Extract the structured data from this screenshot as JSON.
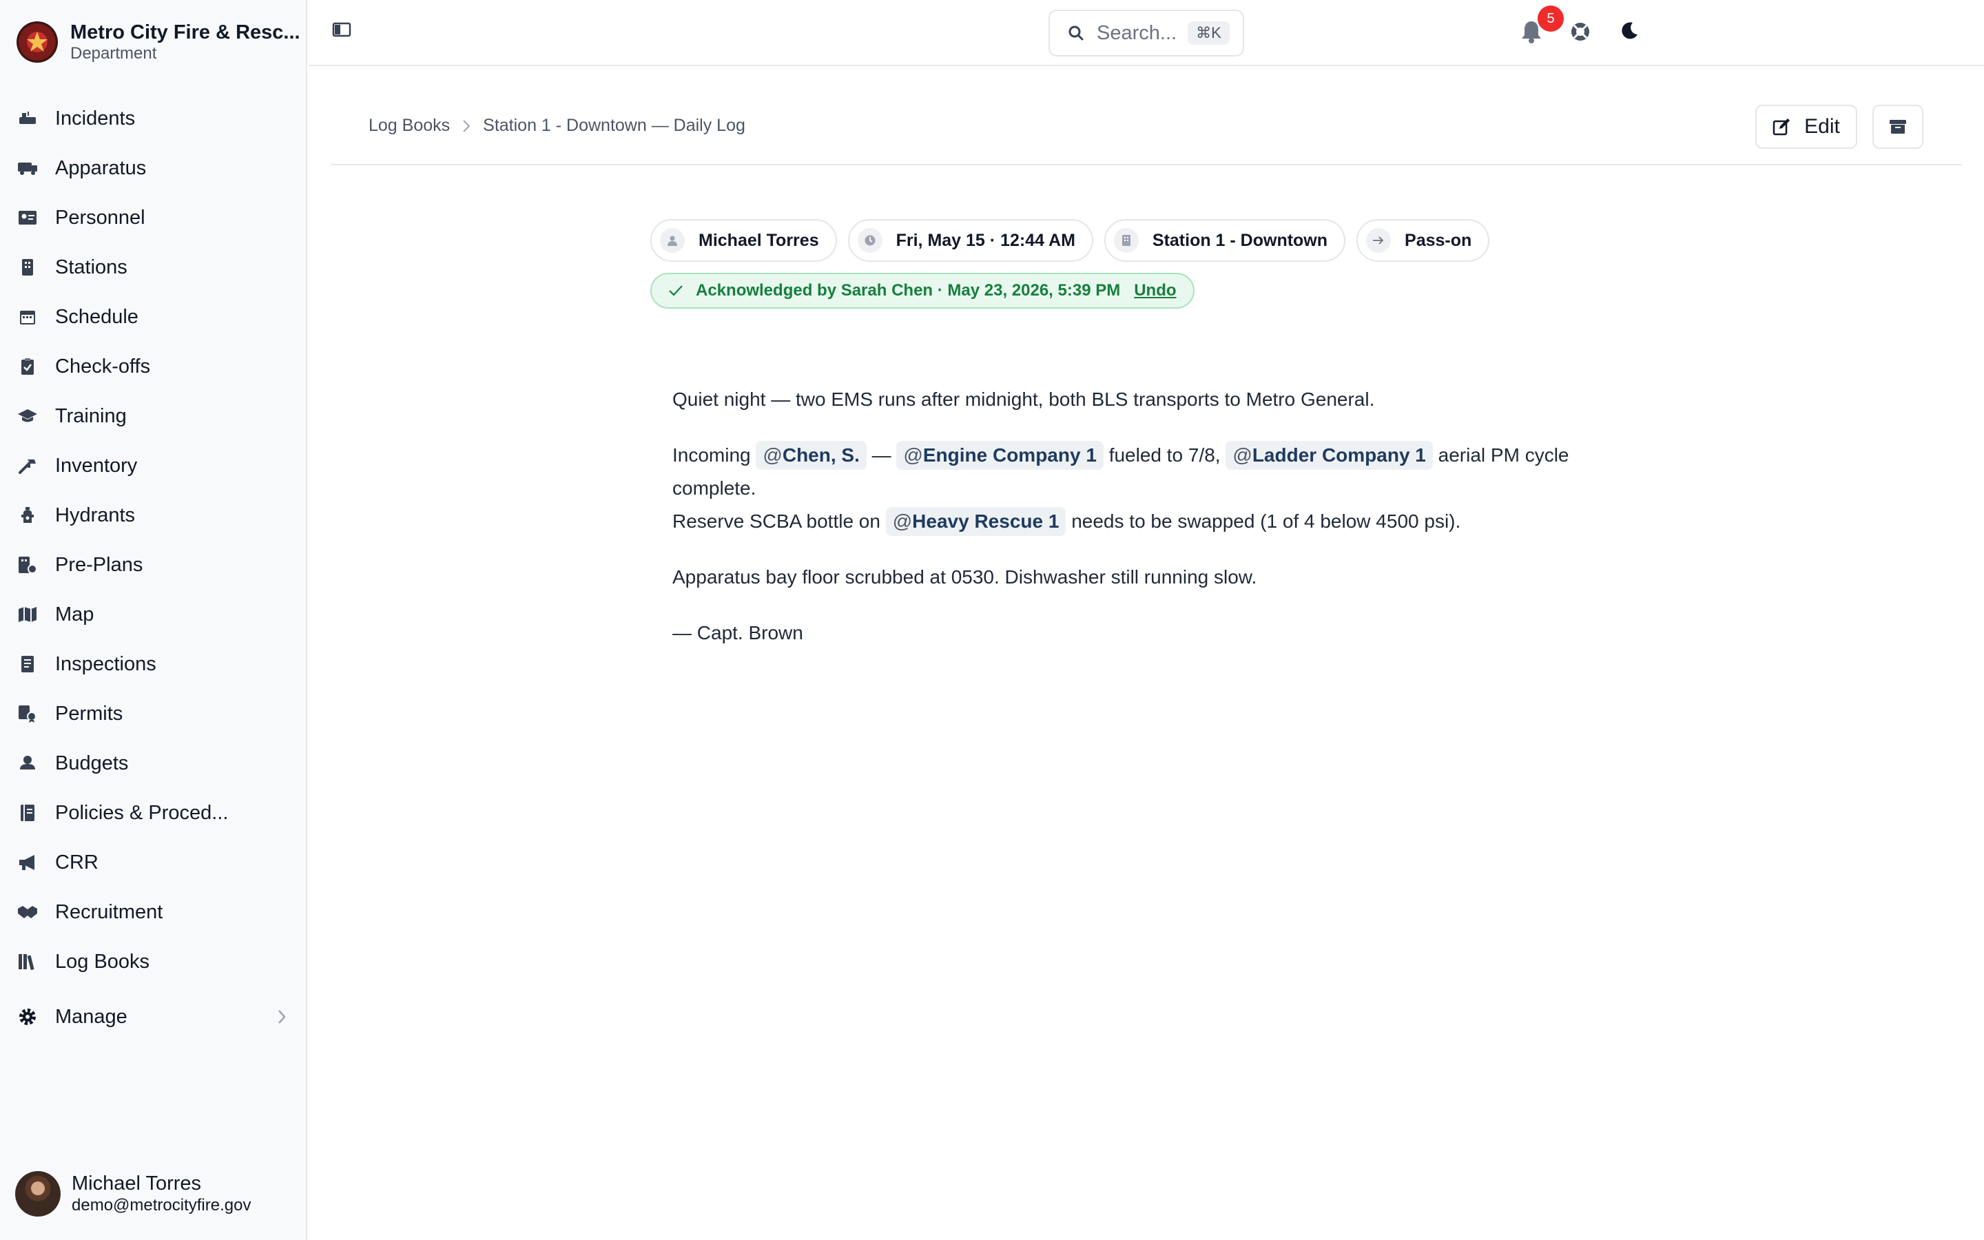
{
  "org": {
    "name": "Metro City Fire & Resc...",
    "subtitle": "Department"
  },
  "nav": {
    "items": [
      {
        "label": "Incidents",
        "icon": "incidents-icon"
      },
      {
        "label": "Apparatus",
        "icon": "apparatus-icon"
      },
      {
        "label": "Personnel",
        "icon": "personnel-icon"
      },
      {
        "label": "Stations",
        "icon": "stations-icon"
      },
      {
        "label": "Schedule",
        "icon": "schedule-icon"
      },
      {
        "label": "Check-offs",
        "icon": "check-offs-icon"
      },
      {
        "label": "Training",
        "icon": "training-icon"
      },
      {
        "label": "Inventory",
        "icon": "inventory-icon"
      },
      {
        "label": "Hydrants",
        "icon": "hydrants-icon"
      },
      {
        "label": "Pre-Plans",
        "icon": "pre-plans-icon"
      },
      {
        "label": "Map",
        "icon": "map-icon"
      },
      {
        "label": "Inspections",
        "icon": "inspections-icon"
      },
      {
        "label": "Permits",
        "icon": "permits-icon"
      },
      {
        "label": "Budgets",
        "icon": "budgets-icon"
      },
      {
        "label": "Policies & Proced...",
        "icon": "policies-icon"
      },
      {
        "label": "CRR",
        "icon": "megaphone-icon"
      },
      {
        "label": "Recruitment",
        "icon": "handshake-icon"
      },
      {
        "label": "Log Books",
        "icon": "log-books-icon"
      }
    ],
    "manage_label": "Manage"
  },
  "user": {
    "name": "Michael Torres",
    "email": "demo@metrocityfire.gov"
  },
  "topbar": {
    "search_placeholder": "Search...",
    "search_shortcut": "⌘K",
    "notification_count": "5"
  },
  "breadcrumb": {
    "parent": "Log Books",
    "current": "Station 1 - Downtown — Daily Log"
  },
  "actions": {
    "edit_label": "Edit"
  },
  "meta": {
    "author": "Michael Torres",
    "datetime": "Fri, May 15 · 12:44 AM",
    "station": "Station 1 - Downtown",
    "type": "Pass-on"
  },
  "ack": {
    "text": "Acknowledged by Sarah Chen · May 23, 2026, 5:39 PM",
    "undo_label": "Undo"
  },
  "body": {
    "p1": "Quiet night — two EMS runs after midnight, both BLS transports to Metro General.",
    "p2_lead": "Incoming",
    "mention1": "Chen, S.",
    "p2_dash": "—",
    "mention2": "Engine Company 1",
    "p2_mid1": "fueled to 7/8,",
    "mention3": "Ladder Company 1",
    "p2_mid2": "aerial PM cycle complete.",
    "p2_line2_lead": "Reserve SCBA bottle on",
    "mention4": "Heavy Rescue 1",
    "p2_tail": "needs to be swapped (1 of 4 below 4500 psi).",
    "p3": "Apparatus bay floor scrubbed at 0530. Dishwasher still running slow.",
    "p4": "— Capt. Brown"
  },
  "colors": {
    "accent_green": "#15803d",
    "badge_red": "#ef2b2b",
    "mention_bg": "#eef1f4"
  }
}
